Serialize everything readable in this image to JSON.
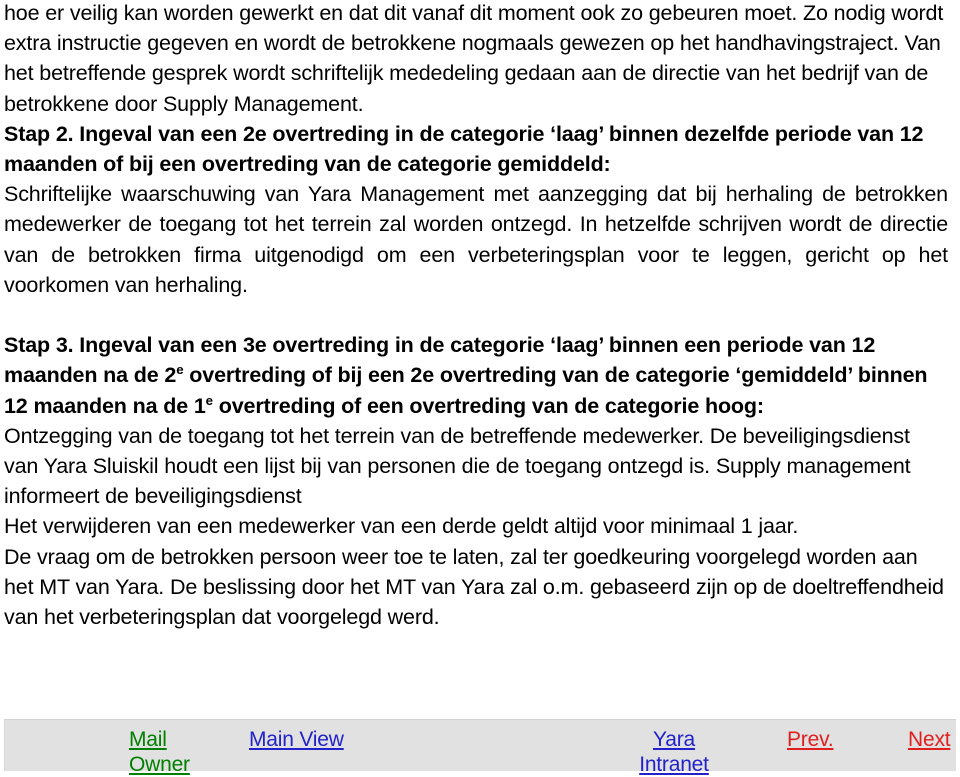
{
  "document": {
    "paragraphs": [
      {
        "id": "intro",
        "align": "left",
        "text": "hoe er veilig kan worden gewerkt en dat dit vanaf dit moment ook zo gebeuren moet. Zo nodig wordt extra instructie gegeven en wordt de betrokkene nogmaals gewezen op het handhavingstraject. Van het betreffende gesprek wordt schriftelijk mededeling gedaan aan de directie van het bedrijf van de betrokkene door Supply Management."
      },
      {
        "id": "stap2-heading",
        "align": "left",
        "text": "Stap 2. Ingeval van een 2e overtreding in de categorie ‘laag’ binnen dezelfde periode van 12 maanden of bij een overtreding van de categorie gemiddeld:"
      },
      {
        "id": "stap2-body",
        "align": "justify",
        "text": "Schriftelijke waarschuwing van Yara Management met aanzegging dat bij herhaling de betrokken medewerker de toegang tot het terrein zal worden ontzegd. In hetzelfde schrijven wordt de directie van de betrokken firma uitgenodigd om een verbeteringsplan voor te leggen, gericht op het voorkomen van herhaling."
      },
      {
        "id": "stap3-heading-part1",
        "align": "left",
        "text": "Stap 3. Ingeval van een 3e overtreding in de categorie ‘laag’ binnen een periode van 12 maanden na de 2"
      },
      {
        "id": "stap3-heading-sup1",
        "text": "e"
      },
      {
        "id": "stap3-heading-part2",
        "text": " overtreding of bij een 2e overtreding van de categorie ‘gemiddeld’ binnen 12 maanden na de 1"
      },
      {
        "id": "stap3-heading-sup2",
        "text": "e"
      },
      {
        "id": "stap3-heading-part3",
        "text": " overtreding of een overtreding van de categorie hoog:"
      },
      {
        "id": "stap3-body-line1",
        "align": "left",
        "text": "Ontzegging van de toegang tot het terrein van de betreffende medewerker. De beveiligingsdienst van Yara Sluiskil houdt een lijst bij van personen die de toegang ontzegd is. Supply management informeert de beveiligingsdienst"
      },
      {
        "id": "stap3-body-line2",
        "align": "left",
        "text": "Het verwijderen van een medewerker van een derde geldt altijd voor minimaal 1 jaar."
      },
      {
        "id": "stap3-body-line3",
        "align": "left",
        "text": "De vraag om de betrokken persoon weer toe te laten, zal ter goedkeuring voorgelegd worden aan het MT van Yara. De beslissing door het MT van Yara zal o.m. gebaseerd zijn op de doeltreffendheid van het verbeteringsplan dat voorgelegd werd."
      }
    ]
  },
  "footer": {
    "background_color": "#e1e1e1",
    "links": [
      {
        "id": "mail-owner",
        "line1": "Mail",
        "line2": "Owner",
        "color": "#008000"
      },
      {
        "id": "main-view",
        "label": "Main View",
        "color": "#2222cc"
      },
      {
        "id": "yara-intranet",
        "line1": "Yara",
        "line2": "Intranet",
        "color": "#2222cc"
      },
      {
        "id": "prev",
        "label": "Prev.",
        "color": "#e02020"
      },
      {
        "id": "next",
        "label": "Next",
        "color": "#e02020"
      }
    ]
  }
}
